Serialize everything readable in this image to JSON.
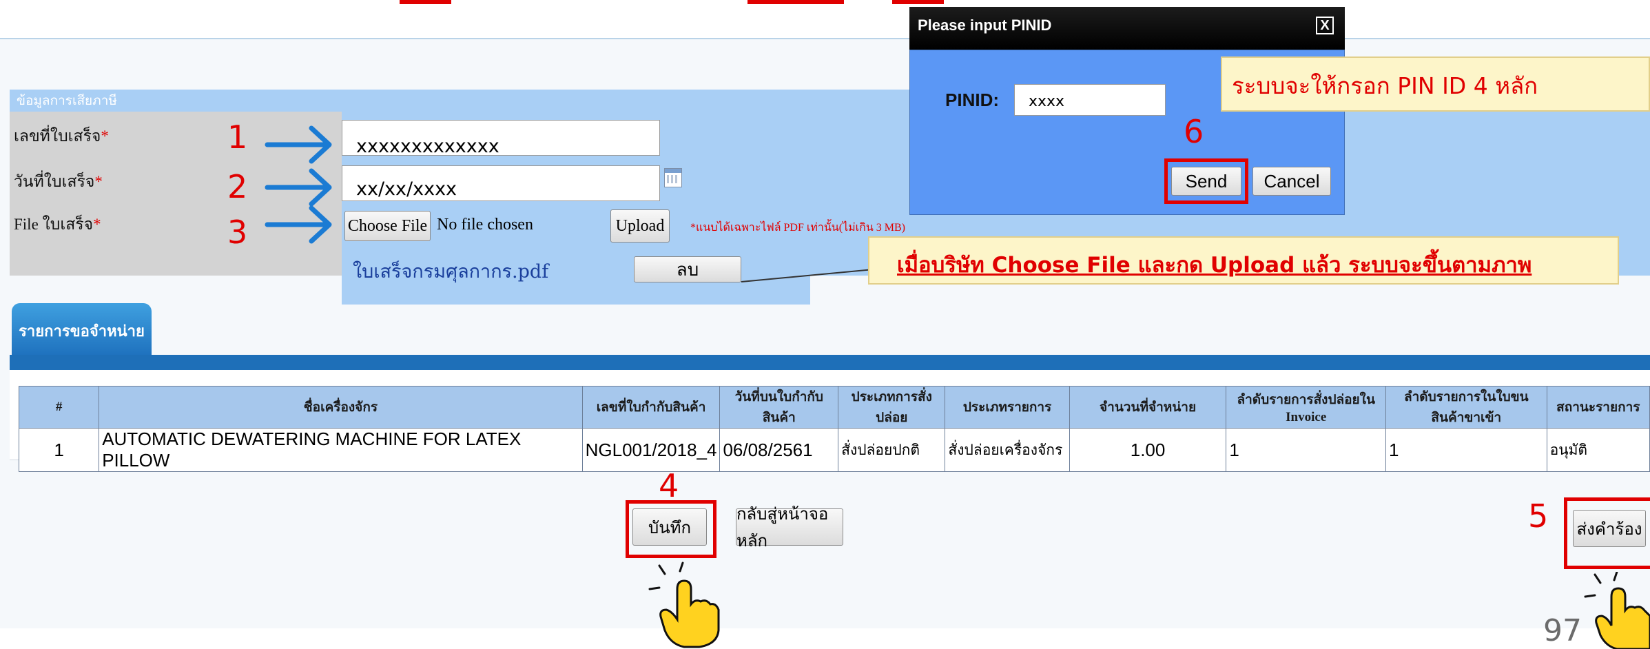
{
  "form": {
    "section_title": "ข้อมูลการเสียภาษี",
    "required_mark": "*",
    "fields": [
      {
        "label": "เลขที่ใบเสร็จ",
        "value": "xxxxxxxxxxxxx",
        "step": "1"
      },
      {
        "label": "วันที่ใบเสร็จ",
        "value": "xx/xx/xxxx",
        "step": "2"
      },
      {
        "label": "File ใบเสร็จ",
        "step": "3"
      }
    ],
    "choose_file_label": "Choose File",
    "no_file_text": "No file chosen",
    "upload_label": "Upload",
    "upload_note": "*แนบได้เฉพาะไฟล์ PDF เท่านั้น(ไม่เกิน 3 MB)",
    "uploaded_file": "ใบเสร็จกรมศุลกากร.pdf",
    "delete_label": "ลบ"
  },
  "annotations": {
    "upload_callout": "เมื่อบริษัท Choose File และกด Upload แล้ว ระบบจะขึ้นตามภาพ",
    "pin_callout": "ระบบจะให้กรอก PIN ID 4 หลัก",
    "step4": "4",
    "step5": "5",
    "step6": "6"
  },
  "tab": {
    "label": "รายการขอจำหน่าย"
  },
  "table": {
    "headers": [
      "#",
      "ชื่อเครื่องจักร",
      "เลขที่ใบกำกับสินค้า",
      "วันที่บนใบกำกับสินค้า",
      "ประเภทการสั่งปล่อย",
      "ประเภทรายการ",
      "จำนวนที่จำหน่าย",
      "ลำดับรายการสั่งปล่อยใน Invoice",
      "ลำดับรายการในใบขนสินค้าขาเข้า",
      "สถานะรายการ"
    ],
    "rows": [
      [
        "1",
        "AUTOMATIC DEWATERING MACHINE FOR LATEX PILLOW",
        "NGL001/2018_4",
        "06/08/2561",
        "สั่งปล่อยปกติ",
        "สั่งปล่อยเครื่องจักร",
        "1.00",
        "1",
        "1",
        "อนุมัติ"
      ]
    ]
  },
  "buttons": {
    "save": "บันทึก",
    "back": "กลับสู่หน้าจอหลัก",
    "submit": "ส่งคำร้อง"
  },
  "dialog": {
    "title": "Please input PINID",
    "close": "X",
    "pin_label": "PINID:",
    "pin_value": "xxxx",
    "send": "Send",
    "cancel": "Cancel"
  },
  "page_number": "97",
  "colors": {
    "section_header": "#a9cff5",
    "tab": "#1e6fb8",
    "annotation_red": "#e00000",
    "arrow_blue": "#1b7bd3",
    "dialog_body": "#5b97f5",
    "callout_bg": "#fdf5c9"
  }
}
